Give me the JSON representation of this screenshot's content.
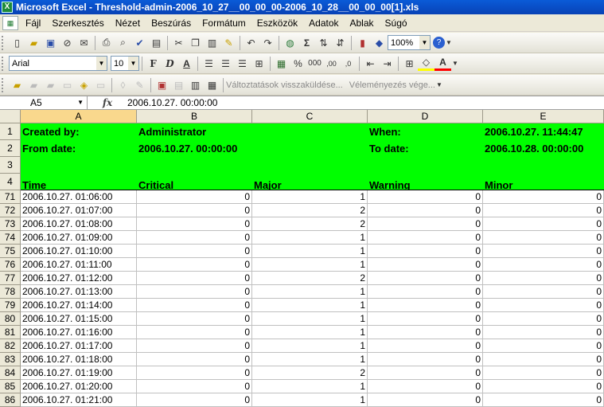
{
  "window": {
    "title": "Microsoft Excel - Threshold-admin-2006_10_27__00_00_00-2006_10_28__00_00_00[1].xls",
    "app_icon_text": "X"
  },
  "menu": [
    "Fájl",
    "Szerkesztés",
    "Nézet",
    "Beszúrás",
    "Formátum",
    "Eszközök",
    "Adatok",
    "Ablak",
    "Súgó"
  ],
  "toolbar": {
    "zoom": "100%",
    "font_name": "Arial",
    "font_size": "10"
  },
  "reviewing_toolbar": {
    "reply_changes": "Változtatások visszaküldése...",
    "end_review": "Véleményezés vége..."
  },
  "formula_bar": {
    "name_box": "A5",
    "fx": "fx",
    "content": "2006.10.27. 00:00:00"
  },
  "columns": [
    "A",
    "B",
    "C",
    "D",
    "E"
  ],
  "header_rows": [
    {
      "num": "1",
      "a": "Created by:",
      "b": "Administrator",
      "c": "",
      "d": "When:",
      "e": "2006.10.27. 11:44:47"
    },
    {
      "num": "2",
      "a": "From date:",
      "b": "2006.10.27. 00:00:00",
      "c": "",
      "d": "To date:",
      "e": "2006.10.28. 00:00:00"
    },
    {
      "num": "3",
      "a": "",
      "b": "",
      "c": "",
      "d": "",
      "e": ""
    },
    {
      "num": "4",
      "a": "Time",
      "b": "Critical",
      "c": "Major",
      "d": "Warning",
      "e": "Minor"
    }
  ],
  "data_rows": [
    {
      "num": "71",
      "time": "2006.10.27. 01:06:00",
      "critical": "0",
      "major": "1",
      "warning": "0",
      "minor": "0"
    },
    {
      "num": "72",
      "time": "2006.10.27. 01:07:00",
      "critical": "0",
      "major": "2",
      "warning": "0",
      "minor": "0"
    },
    {
      "num": "73",
      "time": "2006.10.27. 01:08:00",
      "critical": "0",
      "major": "2",
      "warning": "0",
      "minor": "0"
    },
    {
      "num": "74",
      "time": "2006.10.27. 01:09:00",
      "critical": "0",
      "major": "1",
      "warning": "0",
      "minor": "0"
    },
    {
      "num": "75",
      "time": "2006.10.27. 01:10:00",
      "critical": "0",
      "major": "1",
      "warning": "0",
      "minor": "0"
    },
    {
      "num": "76",
      "time": "2006.10.27. 01:11:00",
      "critical": "0",
      "major": "1",
      "warning": "0",
      "minor": "0"
    },
    {
      "num": "77",
      "time": "2006.10.27. 01:12:00",
      "critical": "0",
      "major": "2",
      "warning": "0",
      "minor": "0"
    },
    {
      "num": "78",
      "time": "2006.10.27. 01:13:00",
      "critical": "0",
      "major": "1",
      "warning": "0",
      "minor": "0"
    },
    {
      "num": "79",
      "time": "2006.10.27. 01:14:00",
      "critical": "0",
      "major": "1",
      "warning": "0",
      "minor": "0"
    },
    {
      "num": "80",
      "time": "2006.10.27. 01:15:00",
      "critical": "0",
      "major": "1",
      "warning": "0",
      "minor": "0"
    },
    {
      "num": "81",
      "time": "2006.10.27. 01:16:00",
      "critical": "0",
      "major": "1",
      "warning": "0",
      "minor": "0"
    },
    {
      "num": "82",
      "time": "2006.10.27. 01:17:00",
      "critical": "0",
      "major": "1",
      "warning": "0",
      "minor": "0"
    },
    {
      "num": "83",
      "time": "2006.10.27. 01:18:00",
      "critical": "0",
      "major": "1",
      "warning": "0",
      "minor": "0"
    },
    {
      "num": "84",
      "time": "2006.10.27. 01:19:00",
      "critical": "0",
      "major": "2",
      "warning": "0",
      "minor": "0"
    },
    {
      "num": "85",
      "time": "2006.10.27. 01:20:00",
      "critical": "0",
      "major": "1",
      "warning": "0",
      "minor": "0"
    },
    {
      "num": "86",
      "time": "2006.10.27. 01:21:00",
      "critical": "0",
      "major": "1",
      "warning": "0",
      "minor": "0"
    }
  ],
  "colors": {
    "header_fill": "#00ff00",
    "title_bar": "#0a5bd8",
    "selected_header": "#f9d88d"
  }
}
